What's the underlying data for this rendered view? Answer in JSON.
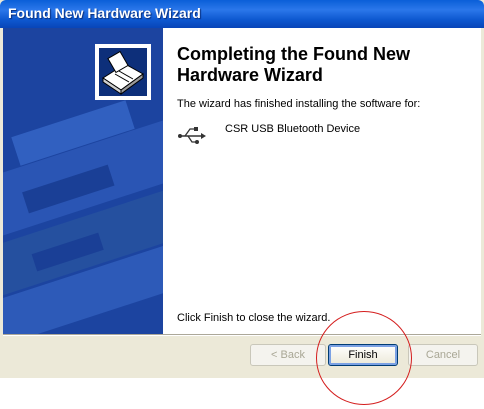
{
  "window": {
    "title": "Found New Hardware Wizard"
  },
  "main": {
    "heading": "Completing the Found New Hardware Wizard",
    "intro": "The wizard has finished installing the software for:",
    "device_name": "CSR USB Bluetooth Device",
    "device_icon": "usb-icon",
    "close_hint": "Click Finish to close the wizard."
  },
  "buttons": {
    "back_label": "< Back",
    "finish_label": "Finish",
    "cancel_label": "Cancel"
  },
  "colors": {
    "titlebar": "#0a5fd8",
    "banner": "#1c44a0",
    "highlight": "#d41d1d"
  }
}
